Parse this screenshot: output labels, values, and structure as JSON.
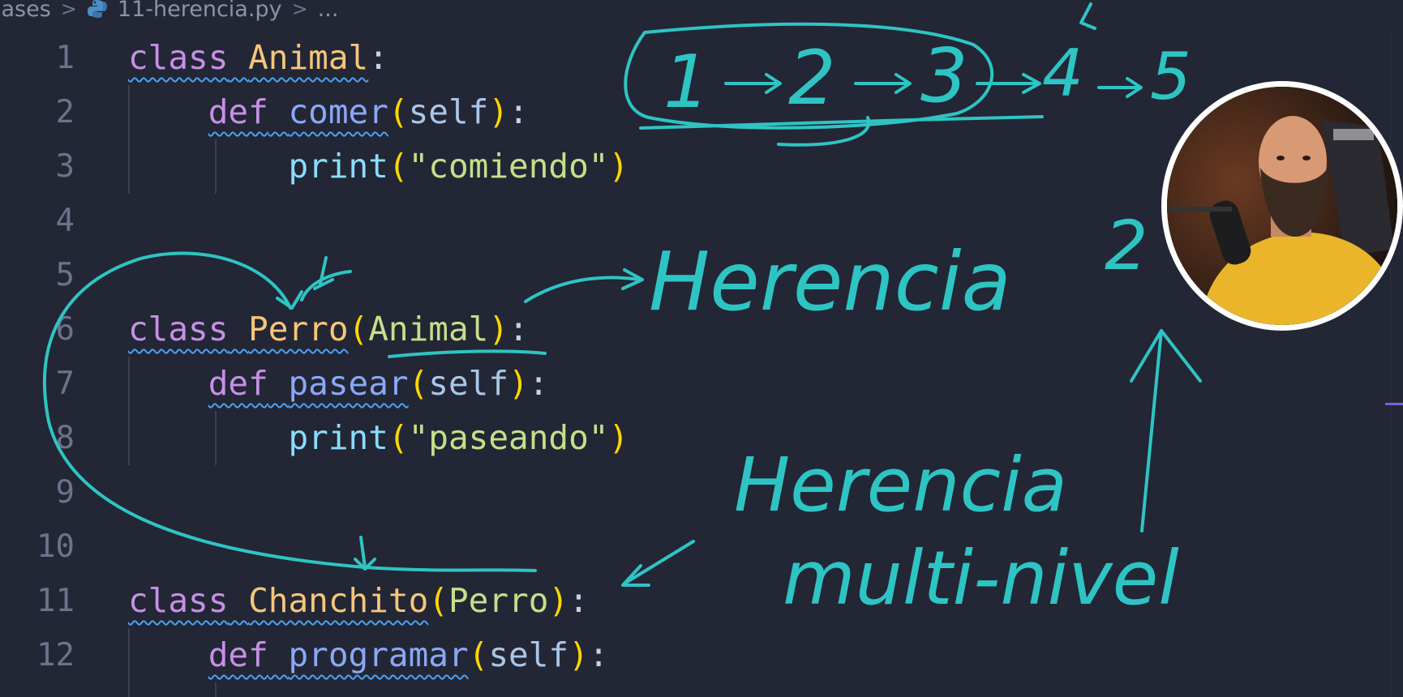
{
  "breadcrumb": {
    "folder": "lases",
    "separator": ">",
    "file": "11-herencia.py",
    "ellipsis": "..."
  },
  "editor": {
    "line_numbers": [
      "1",
      "2",
      "3",
      "4",
      "5",
      "6",
      "7",
      "8",
      "9",
      "10",
      "11",
      "12"
    ],
    "code": {
      "l1": {
        "kw": "class",
        "name": "Animal",
        "colon": ":"
      },
      "l2": {
        "kw": "def",
        "name": "comer",
        "open": "(",
        "param": "self",
        "close": ")",
        "colon": ":"
      },
      "l3": {
        "fn": "print",
        "open": "(",
        "str": "\"comiendo\"",
        "close": ")"
      },
      "l6": {
        "kw": "class",
        "name": "Perro",
        "open": "(",
        "base": "Animal",
        "close": ")",
        "colon": ":"
      },
      "l7": {
        "kw": "def",
        "name": "pasear",
        "open": "(",
        "param": "self",
        "close": ")",
        "colon": ":"
      },
      "l8": {
        "fn": "print",
        "open": "(",
        "str": "\"paseando\"",
        "close": ")"
      },
      "l11": {
        "kw": "class",
        "name": "Chanchito",
        "open": "(",
        "base": "Perro",
        "close": ")",
        "colon": ":"
      },
      "l12": {
        "kw": "def",
        "name": "programar",
        "open": "(",
        "param": "self",
        "close": ")",
        "colon": ":"
      }
    }
  },
  "annotations": {
    "sequence": [
      "1",
      "2",
      "3",
      "4",
      "5"
    ],
    "word_herencia": "Herencia",
    "word_herencia2": "Herencia",
    "word_multinivel": "multi-nivel",
    "number_two": "2",
    "ink_color": "#2ec4c4"
  },
  "webcam": {
    "icon": "presenter-webcam-icon"
  },
  "colors": {
    "background": "#232635",
    "keyword": "#c690e6",
    "class_name": "#f6c67a",
    "function_name": "#8aa8f5",
    "string": "#c4e08a",
    "bracket": "#ffd700"
  }
}
